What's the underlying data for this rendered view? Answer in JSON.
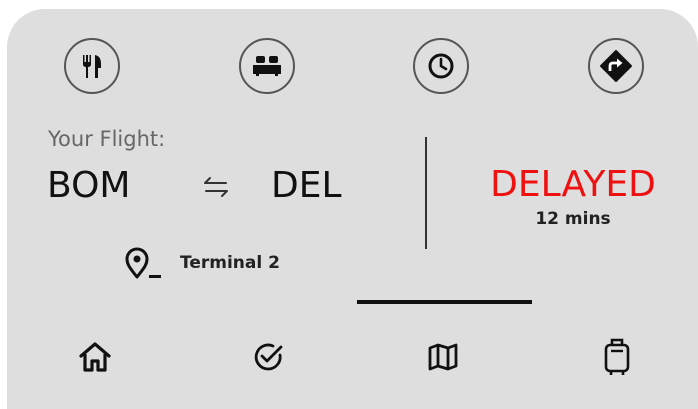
{
  "quick_actions": [
    {
      "icon": "restaurant-icon"
    },
    {
      "icon": "bed-icon"
    },
    {
      "icon": "clock-icon"
    },
    {
      "icon": "directions-icon"
    }
  ],
  "flight": {
    "label": "Your Flight:",
    "origin": "BOM",
    "destination": "DEL",
    "swap_icon": "swap-arrows-icon",
    "status": "DELAYED",
    "delay": "12 mins",
    "terminal": "Terminal 2",
    "location_icon": "location-pin-icon"
  },
  "colors": {
    "status": "#ee1111",
    "card_background": "#dedede"
  },
  "bottom_nav": [
    {
      "icon": "home-icon"
    },
    {
      "icon": "check-circle-icon"
    },
    {
      "icon": "map-icon",
      "active": true
    },
    {
      "icon": "luggage-icon"
    }
  ]
}
